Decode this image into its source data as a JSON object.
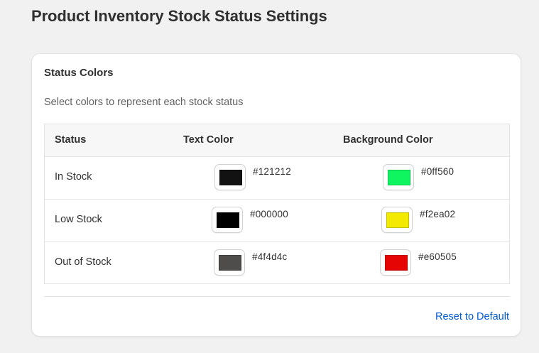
{
  "page": {
    "title": "Product Inventory Stock Status Settings"
  },
  "card": {
    "title": "Status Colors",
    "subtitle": "Select colors to represent each stock status"
  },
  "table": {
    "headers": {
      "status": "Status",
      "text_color": "Text Color",
      "background_color": "Background Color"
    },
    "rows": [
      {
        "status": "In Stock",
        "text_color": "#121212",
        "background_color": "#0ff560"
      },
      {
        "status": "Low Stock",
        "text_color": "#000000",
        "background_color": "#f2ea02"
      },
      {
        "status": "Out of Stock",
        "text_color": "#4f4d4c",
        "background_color": "#e60505"
      }
    ]
  },
  "footer": {
    "reset_label": "Reset to Default"
  },
  "colors": {
    "link": "#005bd3",
    "page_background": "#f1f1f1",
    "card_background": "#ffffff"
  }
}
